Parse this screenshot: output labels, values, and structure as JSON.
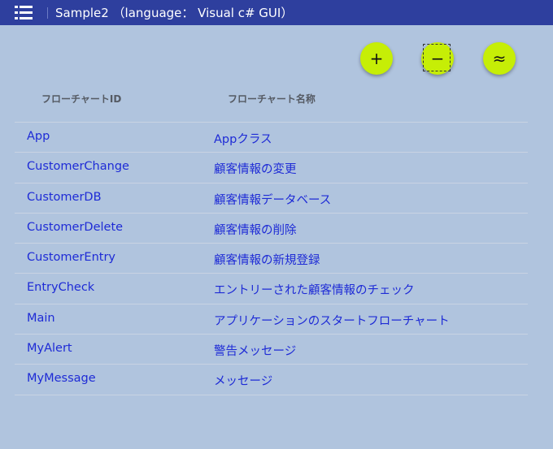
{
  "header": {
    "title": "Sample2 （language： Visual c# GUI）",
    "menu_icon": "list-menu-icon",
    "background_color": "#2e3f9e"
  },
  "actions": {
    "add_label": "+",
    "remove_label": "−",
    "approx_label": "≈",
    "accent_color": "#c6ee06"
  },
  "table": {
    "columns": [
      "フローチャートID",
      "フローチャート名称"
    ],
    "rows": [
      {
        "id": "App",
        "name": "Appクラス"
      },
      {
        "id": "CustomerChange",
        "name": "顧客情報の変更"
      },
      {
        "id": "CustomerDB",
        "name": "顧客情報データベース"
      },
      {
        "id": "CustomerDelete",
        "name": "顧客情報の削除"
      },
      {
        "id": "CustomerEntry",
        "name": "顧客情報の新規登録"
      },
      {
        "id": "EntryCheck",
        "name": "エントリーされた顧客情報のチェック"
      },
      {
        "id": "Main",
        "name": "アプリケーションのスタートフローチャート"
      },
      {
        "id": "MyAlert",
        "name": "警告メッセージ"
      },
      {
        "id": "MyMessage",
        "name": "メッセージ"
      }
    ]
  }
}
